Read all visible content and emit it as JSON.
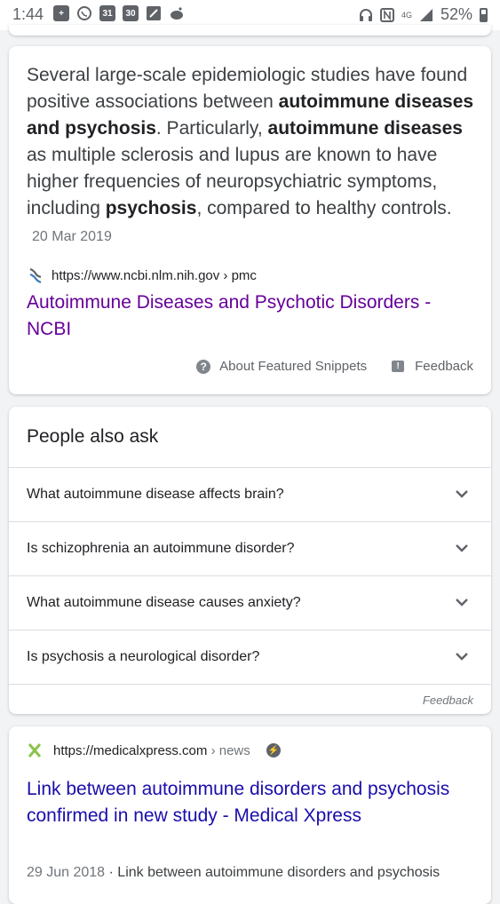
{
  "status_bar": {
    "time": "1:44",
    "calendar_day": "31",
    "calendar_day_2": "30",
    "network": "4G",
    "battery": "52%"
  },
  "featured_snippet": {
    "text_parts": [
      {
        "text": "Several large-scale epidemiologic studies have found positive associations between ",
        "bold": false
      },
      {
        "text": "autoimmune diseases and psychosis",
        "bold": true
      },
      {
        "text": ". Particularly, ",
        "bold": false
      },
      {
        "text": "autoimmune diseases",
        "bold": true
      },
      {
        "text": " as multiple sclerosis and lupus are known to have higher frequencies of neuropsychiatric symptoms, including ",
        "bold": false
      },
      {
        "text": "psychosis",
        "bold": true
      },
      {
        "text": ", compared to healthy controls.",
        "bold": false
      }
    ],
    "date": "20 Mar 2019",
    "source_url": "https://www.ncbi.nlm.nih.gov › pmc",
    "link_title": "Autoimmune Diseases and Psychotic Disorders - NCBI",
    "about_label": "About Featured Snippets",
    "feedback_label": "Feedback",
    "colors": {
      "visited_link": "#660099"
    }
  },
  "people_also_ask": {
    "title": "People also ask",
    "questions": [
      "What autoimmune disease affects brain?",
      "Is schizophrenia an autoimmune disorder?",
      "What autoimmune disease causes anxiety?",
      "Is psychosis a neurological disorder?"
    ],
    "feedback_label": "Feedback"
  },
  "result": {
    "site": "https://medicalxpress.com",
    "crumb": " › news",
    "title": "Link between autoimmune disorders and psychosis confirmed in new study - Medical Xpress",
    "date": "29 Jun 2018",
    "snippet": " · Link between autoimmune disorders and psychosis",
    "colors": {
      "link": "#1a0dab"
    }
  }
}
